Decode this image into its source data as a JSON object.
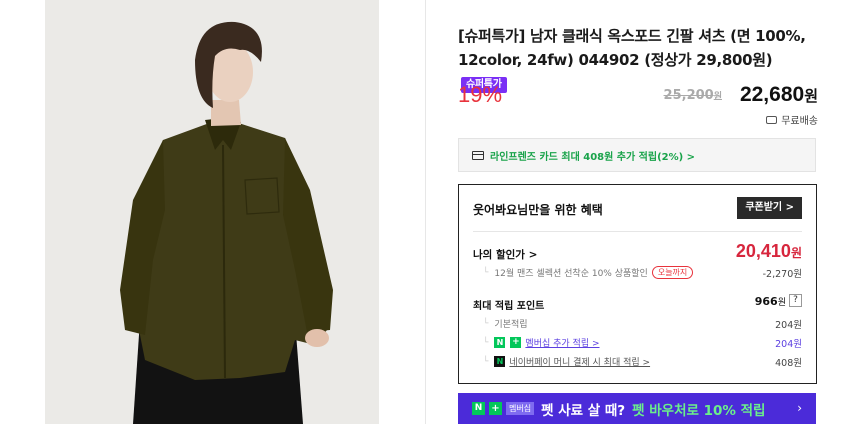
{
  "product": {
    "title": "[슈퍼특가] 남자 클래식 옥스포드 긴팔 셔츠 (면 100%, 12color, 24fw) 044902 (정상가 29,800원)",
    "super_badge": "슈퍼특가",
    "discount_rate": "19%",
    "original_price": "25,200",
    "original_price_unit": "원",
    "final_price": "22,680",
    "final_price_unit": "원",
    "shipping": "무료배송"
  },
  "card_benefit": {
    "text": "라인프렌즈 카드 최대 408원 추가 적립(2%) >"
  },
  "benefits": {
    "title": "웃어봐요님만을 위한 혜택",
    "coupon_button": "쿠폰받기 >",
    "my_price_label": "나의 할인가 >",
    "my_price_value": "20,410",
    "my_price_unit": "원",
    "coupon_detail": "12월 맨즈 셀렉션 선착순 10% 상품할인",
    "today_badge": "오늘까지",
    "coupon_discount": "-2,270원",
    "points_label": "최대 적립 포인트",
    "points_value": "966",
    "points_unit": "원",
    "help": "?",
    "basic_label": "기본적립",
    "basic_value": "204원",
    "member_icon_n": "N",
    "member_icon_plus": "+",
    "member_label": "멤버십 추가 적립 >",
    "member_value": "204원",
    "npay_icon": "N",
    "npay_label": "네이버페이 머니 결제 시 최대 적립 >",
    "npay_value": "408원"
  },
  "banner": {
    "icon_n": "N",
    "icon_plus": "+",
    "member_tag": "멤버십",
    "text_white": "펫 사료 살 때?",
    "text_green": "펫 바우처로 10% 적립",
    "arrow": "›"
  },
  "colors": {
    "accent_red": "#e8333c",
    "super_purple": "#7a2ff5",
    "naver_green": "#03c75a",
    "banner_purple": "#4b2bd9"
  }
}
